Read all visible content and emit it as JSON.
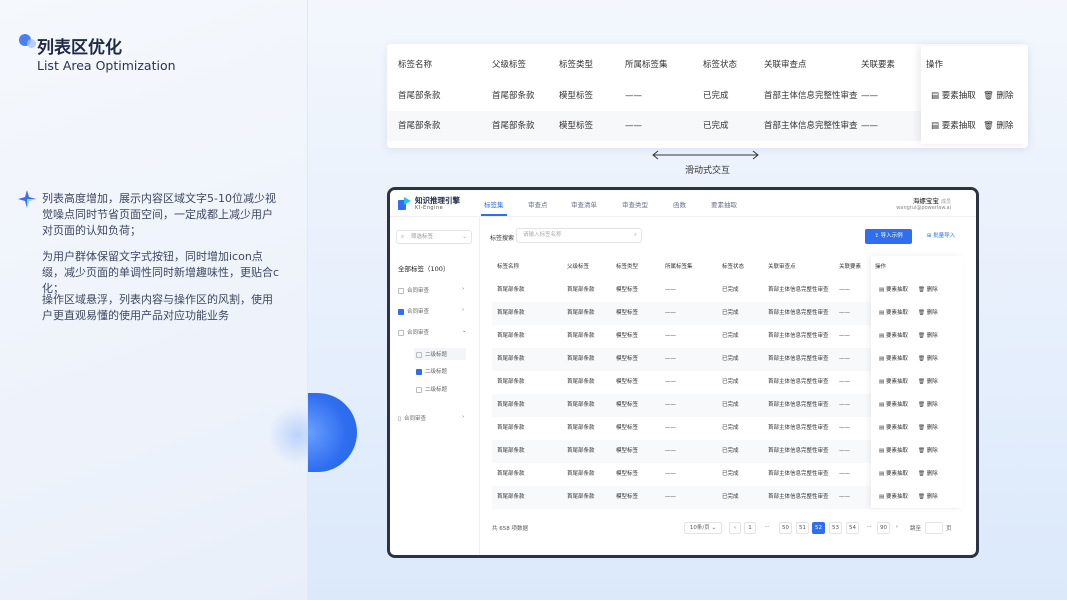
{
  "slide": {
    "title_cn": "列表区优化",
    "title_en": "List Area Optimization",
    "paragraphs": [
      "列表高度增加，展示内容区域文字5-10位减少视觉噪点同时节省页面空间，一定成都上减少用户对页面的认知负荷；",
      "为用户群体保留文字式按钮，同时增加icon点缀，减少页面的单调性同时新增趣味性，更贴合c化；",
      "操作区域悬浮，列表内容与操作区的风割，使用户更直观易懂的使用产品对应功能业务"
    ],
    "scroll_caption": "滑动式交互"
  },
  "strip_table": {
    "headers": [
      "标签名称",
      "父级标签",
      "标签类型",
      "所属标签集",
      "标签状态",
      "关联审查点",
      "关联要素",
      "操作"
    ],
    "rows": [
      [
        "首尾部条款",
        "首尾部条款",
        "模型标签",
        "——",
        "已完成",
        "首部主体信息完整性审查",
        "——"
      ],
      [
        "首尾部条款",
        "首尾部条款",
        "模型标签",
        "——",
        "已完成",
        "首部主体信息完整性审查",
        "——"
      ]
    ],
    "op_extract": "要素抽取",
    "op_delete": "删除"
  },
  "app": {
    "brand": "知识推理引擎",
    "brand_sub": "KI-Engine",
    "nav_tabs": [
      "标签集",
      "审查点",
      "审查清单",
      "审查类型",
      "函数",
      "要素抽取"
    ],
    "active_tab": 0,
    "user_name": "海螺宝宝",
    "user_role": "成员",
    "user_email": "wangrui@powerlaw.ai",
    "sidebar": {
      "search_placeholder": "筛选标签",
      "all_label": "全部标签（100）",
      "items": [
        {
          "label": "合同审查",
          "checked": false
        },
        {
          "label": "合同审查",
          "checked": true
        },
        {
          "label": "合同审查",
          "checked": false
        }
      ],
      "children": [
        {
          "label": "二级标题",
          "checked": false
        },
        {
          "label": "二级标题",
          "checked": true
        },
        {
          "label": "二级标题",
          "checked": false
        }
      ],
      "last_item": "合同审查"
    },
    "filter_label": "标签搜索",
    "filter_placeholder": "请输入标签名称",
    "import_example": "导入示例",
    "batch_import": "批量导入",
    "table_headers": [
      "标签名称",
      "父级标签",
      "标签类型",
      "所属标签集",
      "标签状态",
      "关联审查点",
      "关联要素",
      "操作"
    ],
    "row": [
      "首尾部条款",
      "首尾部条款",
      "模型标签",
      "——",
      "已完成",
      "首部主体信息完整性审查",
      "——"
    ],
    "row_count": 10,
    "op_extract": "要素抽取",
    "op_delete": "删除",
    "total": "共 658 项数据",
    "page_size": "10条/页",
    "pages": [
      "1",
      "···",
      "50",
      "51",
      "52",
      "53",
      "54",
      "···",
      "90"
    ],
    "current_page": "52",
    "jump_label": "跳至",
    "page_unit": "页"
  }
}
